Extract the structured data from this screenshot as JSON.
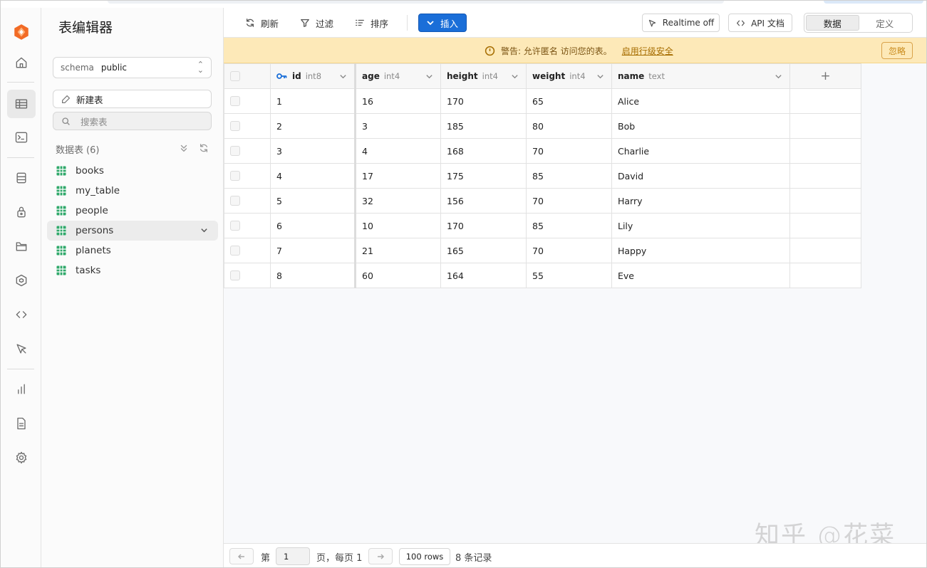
{
  "sidebar": {
    "title": "表编辑器",
    "schema_label": "schema",
    "schema_value": "public",
    "new_table": "新建表",
    "search_placeholder": "搜索表",
    "tables_heading": "数据表",
    "tables_count": "(6)",
    "tables": [
      {
        "label": "books"
      },
      {
        "label": "my_table"
      },
      {
        "label": "people"
      },
      {
        "label": "persons",
        "active": true
      },
      {
        "label": "planets"
      },
      {
        "label": "tasks"
      }
    ]
  },
  "rail_icons": [
    "logo-icon",
    "home-icon",
    "table-editor-icon",
    "sql-editor-icon",
    "database-icon",
    "auth-icon",
    "storage-icon",
    "edge-functions-icon",
    "api-icon",
    "realtime-icon",
    "reports-icon",
    "logs-icon",
    "settings-icon"
  ],
  "toolbar": {
    "refresh": "刷新",
    "filter": "过滤",
    "sort": "排序",
    "insert": "插入",
    "realtime": "Realtime off",
    "api_docs": "API 文档",
    "tab_data": "数据",
    "tab_definition": "定义"
  },
  "warning": {
    "message": "警告: 允许匿名 访问您的表。",
    "link": "启用行级安全",
    "ignore": "忽略"
  },
  "grid": {
    "columns": [
      {
        "name": "id",
        "type": "int8"
      },
      {
        "name": "age",
        "type": "int4"
      },
      {
        "name": "height",
        "type": "int4"
      },
      {
        "name": "weight",
        "type": "int4"
      },
      {
        "name": "name",
        "type": "text"
      }
    ],
    "rows": [
      [
        "1",
        "16",
        "170",
        "65",
        "Alice"
      ],
      [
        "2",
        "3",
        "185",
        "80",
        "Bob"
      ],
      [
        "3",
        "4",
        "168",
        "70",
        "Charlie"
      ],
      [
        "4",
        "17",
        "175",
        "85",
        "David"
      ],
      [
        "5",
        "32",
        "156",
        "70",
        "Harry"
      ],
      [
        "6",
        "10",
        "170",
        "85",
        "Lily"
      ],
      [
        "7",
        "21",
        "165",
        "70",
        "Happy"
      ],
      [
        "8",
        "60",
        "164",
        "55",
        "Eve"
      ]
    ],
    "add_column": "+"
  },
  "footer": {
    "page_prefix": "第",
    "page_value": "1",
    "page_suffix": "页，每页 1",
    "rows_per_page": "100 rows",
    "record_count": "8 条记录"
  },
  "watermark": "知乎 @花菜",
  "colors": {
    "accent": "#1a6ed8",
    "warning_bg": "#fde9b8",
    "brand": "#f26b25"
  }
}
